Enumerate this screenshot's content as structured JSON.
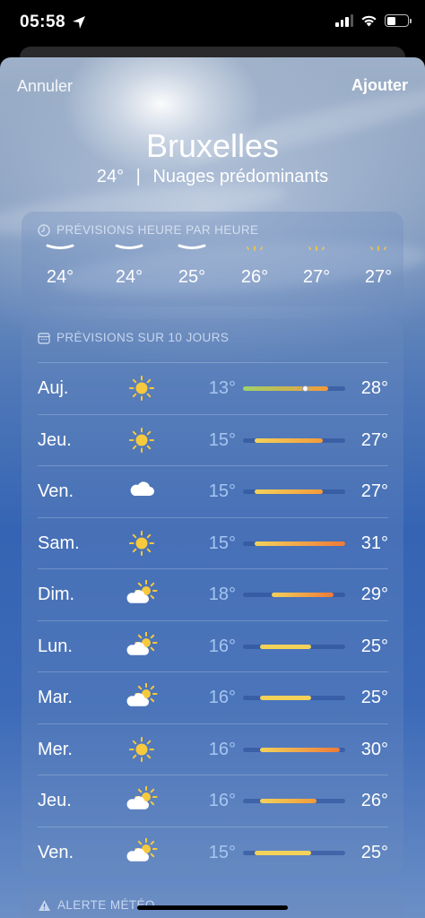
{
  "status": {
    "time": "05:58",
    "location_icon": "location-arrow-icon",
    "signal_icon": "cellular-signal-icon",
    "wifi_icon": "wifi-icon",
    "battery_icon": "battery-icon",
    "battery_level": 0.45
  },
  "nav": {
    "cancel_label": "Annuler",
    "add_label": "Ajouter"
  },
  "location": {
    "city": "Bruxelles",
    "current_temp": "24°",
    "separator": "|",
    "condition": "Nuages prédominants"
  },
  "hourly": {
    "header_icon": "clock-icon",
    "header": "PRÉVISIONS HEURE PAR HEURE",
    "hours": [
      {
        "temp": "24°",
        "icon": "cloud-icon"
      },
      {
        "temp": "24°",
        "icon": "cloud-icon"
      },
      {
        "temp": "25°",
        "icon": "cloud-icon"
      },
      {
        "temp": "26°",
        "icon": "sun-icon"
      },
      {
        "temp": "27°",
        "icon": "sun-icon"
      },
      {
        "temp": "27°",
        "icon": "sun-icon"
      }
    ]
  },
  "daily": {
    "header_icon": "calendar-icon",
    "header": "PRÉVISIONS SUR 10 JOURS",
    "range_min": 13,
    "range_max": 31,
    "current_temp": 24,
    "days": [
      {
        "name": "Auj.",
        "icon": "sun-icon",
        "low": 13,
        "high": 28,
        "low_label": "13°",
        "high_label": "28°"
      },
      {
        "name": "Jeu.",
        "icon": "sun-icon",
        "low": 15,
        "high": 27,
        "low_label": "15°",
        "high_label": "27°"
      },
      {
        "name": "Ven.",
        "icon": "cloud-icon",
        "low": 15,
        "high": 27,
        "low_label": "15°",
        "high_label": "27°"
      },
      {
        "name": "Sam.",
        "icon": "sun-icon",
        "low": 15,
        "high": 31,
        "low_label": "15°",
        "high_label": "31°"
      },
      {
        "name": "Dim.",
        "icon": "partly-cloudy-icon",
        "low": 18,
        "high": 29,
        "low_label": "18°",
        "high_label": "29°"
      },
      {
        "name": "Lun.",
        "icon": "partly-cloudy-icon",
        "low": 16,
        "high": 25,
        "low_label": "16°",
        "high_label": "25°"
      },
      {
        "name": "Mar.",
        "icon": "partly-cloudy-icon",
        "low": 16,
        "high": 25,
        "low_label": "16°",
        "high_label": "25°"
      },
      {
        "name": "Mer.",
        "icon": "sun-icon",
        "low": 16,
        "high": 30,
        "low_label": "16°",
        "high_label": "30°"
      },
      {
        "name": "Jeu.",
        "icon": "partly-cloudy-icon",
        "low": 16,
        "high": 26,
        "low_label": "16°",
        "high_label": "26°"
      },
      {
        "name": "Ven.",
        "icon": "partly-cloudy-icon",
        "low": 15,
        "high": 25,
        "low_label": "15°",
        "high_label": "25°"
      }
    ]
  },
  "alert": {
    "icon": "warning-icon",
    "header": "ALERTE MÉTÉO"
  },
  "colors": {
    "sun": "#f7c93c",
    "cool": "#9ed36a",
    "mid": "#f3d25a",
    "warm": "#f39a3a",
    "hot": "#ee7a3a"
  }
}
